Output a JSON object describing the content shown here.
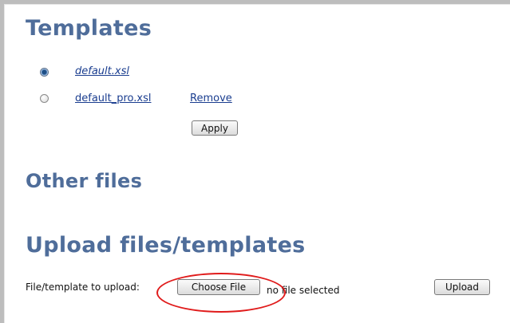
{
  "templates": {
    "title": "Templates",
    "items": [
      {
        "name": "default.xsl",
        "selected": true
      },
      {
        "name": "default_pro.xsl",
        "selected": false,
        "remove_label": "Remove"
      }
    ],
    "apply_label": "Apply"
  },
  "other_files": {
    "title": "Other files"
  },
  "upload": {
    "title": "Upload files/templates",
    "field_label": "File/template to upload:",
    "choose_label": "Choose File",
    "no_file_text": "no file selected",
    "upload_label": "Upload"
  },
  "colors": {
    "heading": "#4f6d9a",
    "link": "#1a3d8f",
    "annotation": "#e01b1b"
  }
}
